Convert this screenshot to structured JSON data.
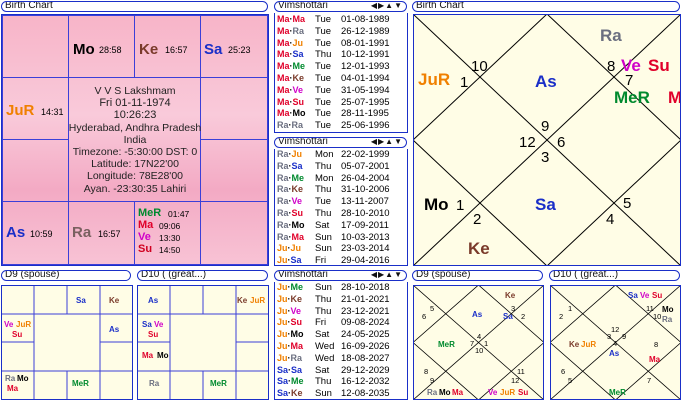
{
  "panels": {
    "birth_left_title": "Birth Chart",
    "birth_right_title": "Birth Chart",
    "vim1_title": "Vimshottari",
    "vim2_title": "Vimshottari",
    "vim3_title": "Vimshottari",
    "d9_left_title": "D9 (spouse)",
    "d10_left_title": "D10 ( (great...)",
    "d9_right_title": "D9 (spouse)",
    "d10_right_title": "D10 ( (great...)",
    "arrows": "◀▶▲▼"
  },
  "birth_info": {
    "name": "V V S Lakshmam",
    "date": "Fri 01-11-1974",
    "time": "10:26:23",
    "place": "Hyderabad, Andhra Pradesh",
    "country": "India",
    "timezone": "Timezone: -5:30:00 DST: 0",
    "latitude": "Latitude: 17N22'00",
    "longitude": "Longitude: 78E28'00",
    "ayanamsa": "Ayan. -23:30:35 Lahiri"
  },
  "south_chart": {
    "mo": "Mo",
    "mo_deg": "28:58",
    "ke": "Ke",
    "ke_deg": "16:57",
    "sa": "Sa",
    "sa_deg": "25:23",
    "jur": "JuR",
    "jur_deg": "14:31",
    "as": "As",
    "as_deg": "10:59",
    "ra": "Ra",
    "ra_deg": "16:57",
    "mer": "MeR",
    "mer_deg": "01:47",
    "ma": "Ma",
    "ma_deg": "09:06",
    "ve": "Ve",
    "ve_deg": "13:30",
    "su": "Su",
    "su_deg": "14:50"
  },
  "north_chart": {
    "ra": "Ra",
    "n10": "10",
    "jur": "JuR",
    "n11": "1",
    "as": "As",
    "n8": "8",
    "ve": "Ve",
    "su": "Su",
    "n7": "7",
    "mer": "MeR",
    "ma": "M",
    "n9": "9",
    "n12": "12",
    "n6": "6",
    "n3": "3",
    "mo": "Mo",
    "n1": "1",
    "n2": "2",
    "sa": "Sa",
    "n5": "5",
    "n4": "4",
    "ke": "Ke"
  },
  "vim1": [
    [
      "Ma·Ma",
      "Tue",
      "01-08-1989"
    ],
    [
      "Ma·Ra",
      "Tue",
      "26-12-1989"
    ],
    [
      "Ma·Ju",
      "Tue",
      "08-01-1991"
    ],
    [
      "Ma·Sa",
      "Thu",
      "10-12-1991"
    ],
    [
      "Ma·Me",
      "Tue",
      "12-01-1993"
    ],
    [
      "Ma·Ke",
      "Tue",
      "04-01-1994"
    ],
    [
      "Ma·Ve",
      "Tue",
      "31-05-1994"
    ],
    [
      "Ma·Su",
      "Tue",
      "25-07-1995"
    ],
    [
      "Ma·Mo",
      "Tue",
      "28-11-1995"
    ],
    [
      "Ra·Ra",
      "Tue",
      "25-06-1996"
    ]
  ],
  "vim2": [
    [
      "Ra·Ju",
      "Mon",
      "22-02-1999"
    ],
    [
      "Ra·Sa",
      "Thu",
      "05-07-2001"
    ],
    [
      "Ra·Me",
      "Mon",
      "26-04-2004"
    ],
    [
      "Ra·Ke",
      "Thu",
      "31-10-2006"
    ],
    [
      "Ra·Ve",
      "Tue",
      "13-11-2007"
    ],
    [
      "Ra·Su",
      "Thu",
      "28-10-2010"
    ],
    [
      "Ra·Mo",
      "Sat",
      "17-09-2011"
    ],
    [
      "Ra·Ma",
      "Sun",
      "10-03-2013"
    ],
    [
      "Ju·Ju",
      "Sun",
      "23-03-2014"
    ],
    [
      "Ju·Sa",
      "Fri",
      "29-04-2016"
    ]
  ],
  "vim3": [
    [
      "Ju·Me",
      "Sun",
      "28-10-2018"
    ],
    [
      "Ju·Ke",
      "Thu",
      "21-01-2021"
    ],
    [
      "Ju·Ve",
      "Thu",
      "23-12-2021"
    ],
    [
      "Ju·Su",
      "Fri",
      "09-08-2024"
    ],
    [
      "Ju·Mo",
      "Sat",
      "24-05-2025"
    ],
    [
      "Ju·Ma",
      "Wed",
      "16-09-2026"
    ],
    [
      "Ju·Ra",
      "Wed",
      "18-08-2027"
    ],
    [
      "Sa·Sa",
      "Sat",
      "29-12-2029"
    ],
    [
      "Sa·Me",
      "Thu",
      "16-12-2032"
    ],
    [
      "Sa·Ke",
      "Sun",
      "12-08-2035"
    ]
  ],
  "d9_south": {
    "sa": "Sa",
    "ke": "Ke",
    "ve": "Ve",
    "jur": "JuR",
    "su": "Su",
    "as": "As",
    "ra": "Ra",
    "mo": "Mo",
    "ma": "Ma",
    "mer": "MeR"
  },
  "d10_south": {
    "as": "As",
    "ke": "Ke",
    "jur": "JuR",
    "sa": "Sa",
    "ve": "Ve",
    "su": "Su",
    "ma": "Ma",
    "mo": "Mo",
    "ra": "Ra",
    "mer": "MeR"
  },
  "d9_north": {
    "ke": "Ke",
    "n5": "5",
    "n6": "6",
    "n3": "3",
    "n2": "2",
    "sa": "Sa",
    "as": "As",
    "n4": "4",
    "n7": "7",
    "n1": "1",
    "n10": "10",
    "mer": "MeR",
    "n8": "8",
    "n9": "9",
    "n11": "11",
    "n12": "12",
    "ra": "Ra",
    "mo": "Mo",
    "ma": "Ma",
    "ve": "Ve",
    "jur": "JuR",
    "su": "Su"
  },
  "d10_north": {
    "sa": "Sa",
    "ve": "Ve",
    "su": "Su",
    "n1": "1",
    "n2": "2",
    "n11": "11",
    "n12": "12",
    "n10": "10",
    "mo": "Mo",
    "ra": "Ra",
    "n3": "3",
    "n9": "9",
    "n4": "4",
    "jur": "JuR",
    "ke": "Ke",
    "as": "As",
    "n6": "6",
    "n8": "8",
    "ma": "Ma",
    "n5": "5",
    "n7": "7",
    "mer": "MeR"
  }
}
